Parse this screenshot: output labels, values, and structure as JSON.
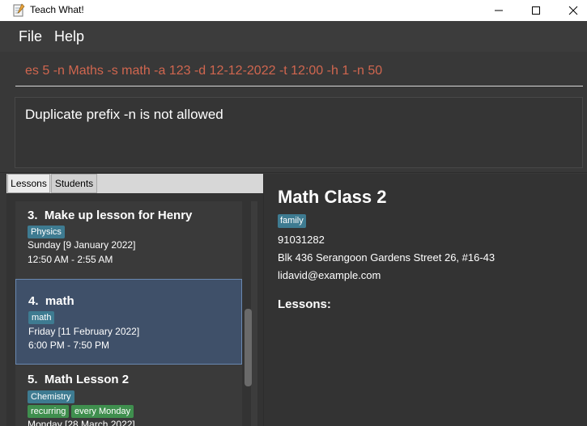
{
  "window": {
    "title": "Teach What!"
  },
  "menu": {
    "file": "File",
    "help": "Help"
  },
  "command": {
    "value": "es 5 -n Maths -s math -a 123 -d 12-12-2022 -t 12:00 -h 1 -n 50"
  },
  "result": {
    "message": "Duplicate prefix -n is not allowed"
  },
  "tabs": {
    "lessons": "Lessons",
    "students": "Students"
  },
  "lessons": [
    {
      "title": "3.  Make up lesson for Henry",
      "tags": [
        {
          "label": "Physics",
          "color": "blue"
        }
      ],
      "date": "Sunday [9 January 2022]",
      "time": "12:50 AM - 2:55 AM",
      "selected": false
    },
    {
      "title": "4.  math",
      "tags": [
        {
          "label": "math",
          "color": "blue"
        }
      ],
      "date": "Friday [11 February 2022]",
      "time": "6:00 PM - 7:50 PM",
      "selected": true
    },
    {
      "title": "5.  Math Lesson 2",
      "tags": [
        {
          "label": "Chemistry",
          "color": "blue"
        },
        {
          "label": "recurring",
          "color": "green"
        },
        {
          "label": "every Monday",
          "color": "green"
        }
      ],
      "date": "Monday [28 March 2022]",
      "time": "",
      "selected": false
    }
  ],
  "detail": {
    "name": "Math Class 2",
    "tag": "family",
    "phone": "91031282",
    "address": "Blk 436 Serangoon Gardens Street 26, #16-43",
    "email": "lidavid@example.com",
    "lessons_label": "Lessons:"
  },
  "colors": {
    "command_text": "#d0664f",
    "tag_blue": "#3e7b91",
    "tag_green": "#3f8f4e",
    "selected_card": "#3f5069"
  }
}
